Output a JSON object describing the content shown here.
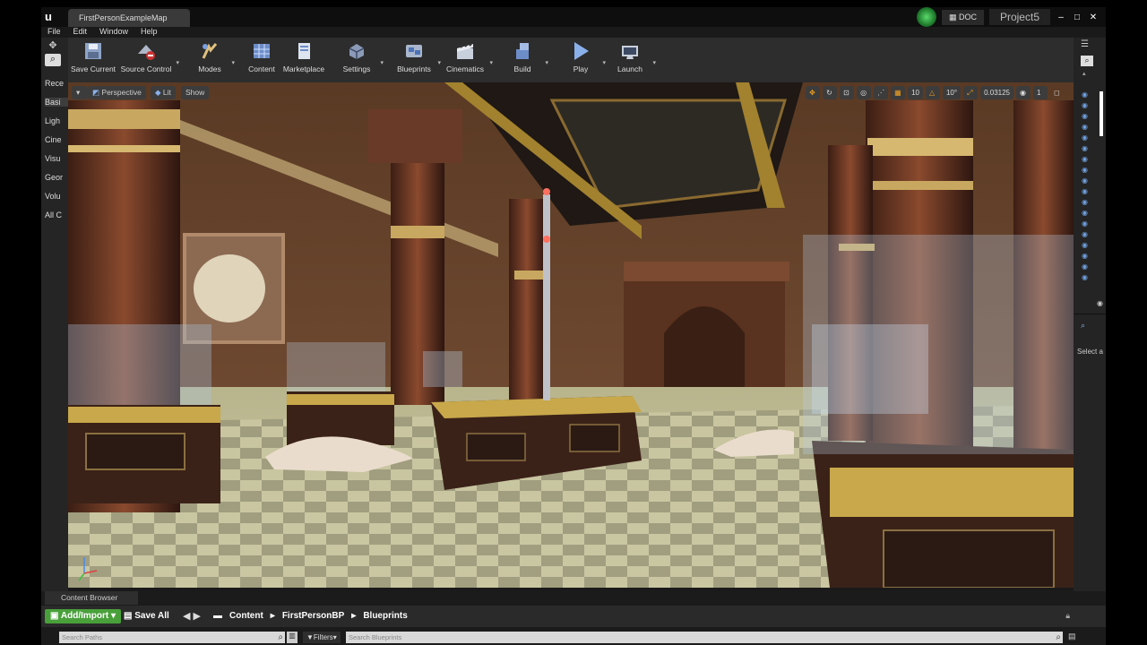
{
  "window": {
    "tab_title": "FirstPersonExampleMap",
    "doc_button": "DOC",
    "project_name": "Project5",
    "controls": [
      "–",
      "□",
      "✕"
    ]
  },
  "menu": [
    "File",
    "Edit",
    "Window",
    "Help"
  ],
  "modes_panel": {
    "items": [
      "Rece",
      "Basi",
      "Ligh",
      "Cine",
      "Visu",
      "Geor",
      "Volu",
      "All C"
    ],
    "selected_index": 1
  },
  "toolbar": {
    "buttons": [
      {
        "label": "Save Current",
        "icon": "save-icon"
      },
      {
        "label": "Source Control",
        "icon": "source-control-icon"
      },
      {
        "label": "Modes",
        "icon": "modes-icon"
      },
      {
        "label": "Content",
        "icon": "content-icon"
      },
      {
        "label": "Marketplace",
        "icon": "marketplace-icon"
      },
      {
        "label": "Settings",
        "icon": "settings-icon"
      },
      {
        "label": "Blueprints",
        "icon": "blueprints-icon"
      },
      {
        "label": "Cinematics",
        "icon": "cinematics-icon"
      },
      {
        "label": "Build",
        "icon": "build-icon"
      },
      {
        "label": "Play",
        "icon": "play-icon"
      },
      {
        "label": "Launch",
        "icon": "launch-icon"
      }
    ]
  },
  "viewport": {
    "perspective_label": "Perspective",
    "lit_label": "Lit",
    "show_label": "Show",
    "grid_snap": "10",
    "rotation_snap": "10°",
    "scale_snap": "0.03125",
    "camera_speed": "1"
  },
  "details_panel": {
    "select_hint": "Select a"
  },
  "content_browser": {
    "tab_label": "Content Browser",
    "add_import_label": "Add/Import",
    "save_all_label": "Save All",
    "breadcrumbs": [
      "Content",
      "FirstPersonBP",
      "Blueprints"
    ],
    "search_paths_placeholder": "Search Paths",
    "filters_label": "Filters",
    "search_blueprints_placeholder": "Search Blueprints"
  }
}
